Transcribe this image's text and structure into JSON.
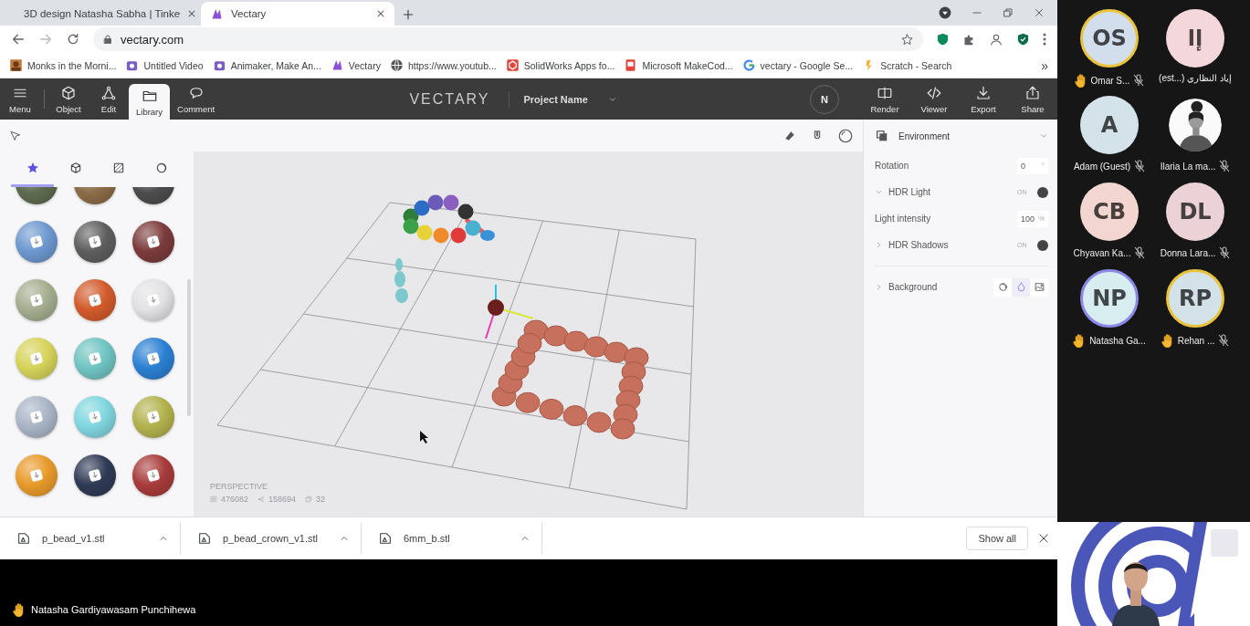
{
  "browser": {
    "tabs": [
      {
        "title": "3D design Natasha Sabha | Tinke",
        "selected": false
      },
      {
        "title": "Vectary",
        "selected": true
      }
    ],
    "address": "vectary.com",
    "bookmarks": [
      "Monks in the Morni...",
      "Untitled Video",
      "Animaker, Make An...",
      "Vectary",
      "https://www.youtub...",
      "SolidWorks Apps fo...",
      "Microsoft MakeCod...",
      "vectary - Google Se...",
      "Scratch - Search"
    ],
    "more_bookmarks": "»"
  },
  "app": {
    "tools_left": [
      {
        "label": "Menu",
        "selected": false
      },
      {
        "label": "Object",
        "selected": false
      },
      {
        "label": "Edit",
        "selected": false
      },
      {
        "label": "Library",
        "selected": true
      },
      {
        "label": "Comment",
        "selected": false
      }
    ],
    "logo": "VECTARY",
    "project": "Project Name",
    "user_initial": "N",
    "tools_right": [
      "Render",
      "Viewer",
      "Export",
      "Share"
    ],
    "library_tabs": [
      {
        "selected": true
      },
      {
        "selected": false
      },
      {
        "selected": false
      },
      {
        "selected": false
      }
    ],
    "materials": [
      {
        "color": "#5f6b50"
      },
      {
        "color": "#8c6c47"
      },
      {
        "color": "#4d4d4d"
      },
      {
        "color": "#6d98cf"
      },
      {
        "color": "#5e5e5e"
      },
      {
        "color": "#7b3b3b"
      },
      {
        "color": "#a5ae8f"
      },
      {
        "color": "#d25b2b"
      },
      {
        "color": "#e2e2e4"
      },
      {
        "color": "#d6d35a"
      },
      {
        "color": "#6fc4c2"
      },
      {
        "color": "#2b80d3"
      },
      {
        "color": "#a9b5c6"
      },
      {
        "color": "#80d6df"
      },
      {
        "color": "#b3b24d"
      },
      {
        "color": "#e89a2b"
      },
      {
        "color": "#2f3a55"
      },
      {
        "color": "#a83b3b"
      }
    ],
    "viewport": {
      "camera": "PERSPECTIVE",
      "stats": [
        "476082",
        "158694",
        "32"
      ]
    },
    "panel": {
      "title": "Environment",
      "rows": [
        {
          "kind": "field",
          "label": "Rotation",
          "value": "0",
          "unit": "°"
        },
        {
          "kind": "toggle",
          "label": "HDR Light",
          "expanded": true,
          "on": true,
          "state_label": "ON"
        },
        {
          "kind": "field",
          "label": "Light intensity",
          "value": "100",
          "unit": "%"
        },
        {
          "kind": "toggle",
          "label": "HDR Shadows",
          "expanded": false,
          "on": true,
          "state_label": "ON"
        },
        {
          "kind": "picker",
          "label": "Background",
          "expanded": false,
          "options": [
            {
              "selected": false
            },
            {
              "selected": true
            },
            {
              "selected": false
            }
          ]
        }
      ]
    }
  },
  "downloads": {
    "files": [
      "p_bead_v1.stl",
      "p_bead_crown_v1.stl",
      "6mm_b.stl"
    ],
    "show_all": "Show all"
  },
  "presenter": {
    "name": "Natasha Gardiyawasam Punchihewa",
    "hand_raised": true
  },
  "participants": [
    {
      "kind": "initials",
      "initials": "OS",
      "name": "Omar S...",
      "color": "#d3deed",
      "hand_raised": true,
      "speaking": false,
      "muted": true
    },
    {
      "kind": "initials",
      "initials": "إا",
      "name": "إياد النظاري (...est)",
      "color": "#f3d7da",
      "hand_raised": false,
      "speaking": false,
      "muted": false
    },
    {
      "kind": "initials",
      "initials": "A",
      "name": "Adam (Guest)",
      "color": "#d4e3ea",
      "hand_raised": false,
      "speaking": false,
      "muted": true
    },
    {
      "name": "Ilaria La ma...",
      "hand_raised": false,
      "speaking": false,
      "muted": true
    },
    {
      "kind": "initials",
      "initials": "CB",
      "name": "Chyavan Ka...",
      "color": "#f2d6cf",
      "hand_raised": false,
      "speaking": false,
      "muted": true
    },
    {
      "kind": "initials",
      "initials": "DL",
      "name": "Donna Lara...",
      "color": "#ead2d6",
      "hand_raised": false,
      "speaking": false,
      "muted": true
    },
    {
      "kind": "initials",
      "initials": "NP",
      "name": "Natasha Ga...",
      "color": "#d7edf0",
      "hand_raised": true,
      "speaking": true,
      "muted": false
    },
    {
      "kind": "initials",
      "initials": "RP",
      "name": "Rehan ...",
      "color": "#d3e2e8",
      "hand_raised": true,
      "speaking": false,
      "muted": true
    }
  ]
}
